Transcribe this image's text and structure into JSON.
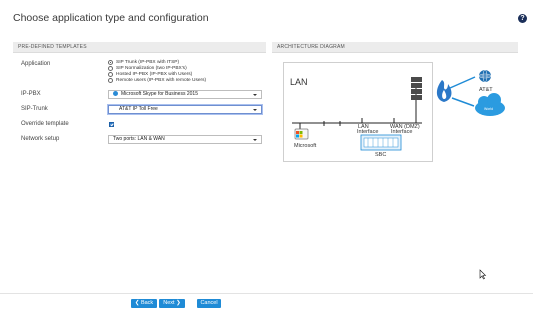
{
  "page": {
    "title": "Choose application type and configuration",
    "help_icon": "?"
  },
  "left": {
    "header": "PRE-DEFINED TEMPLATES",
    "application_label": "Application",
    "application_options": [
      "SIP Trunk (IP-PBX with ITSP)",
      "SIP Normalization (two IP-PBX's)",
      "Hosted IP-PBX (IP-PBX with Users)",
      "Remote users (IP-PBX with remote Users)"
    ],
    "ippbx_label": "IP-PBX",
    "ippbx_value": "Microsoft Skype for Business 2015",
    "siptrunk_label": "SIP-Trunk",
    "siptrunk_value": "AT&T IP Toll Free",
    "override_label": "Override template",
    "network_label": "Network setup",
    "network_value": "Two ports: LAN & WAN"
  },
  "right": {
    "header": "ARCHITECTURE DIAGRAM",
    "diagram": {
      "lan_label": "LAN",
      "lan_interface_label_1": "LAN",
      "lan_interface_label_2": "Interface",
      "wan_interface_label_1": "WAN (DMZ)",
      "wan_interface_label_2": "Interface",
      "microsoft_label": "Microsoft",
      "sbc_label": "SBC",
      "att_label": "AT&T",
      "cloud_label": "World"
    }
  },
  "footer": {
    "back_label": "❮ Back",
    "next_label": "Next ❯",
    "cancel_label": "Cancel"
  },
  "colors": {
    "accent": "#1f8bd6",
    "fire": "#2b78c8",
    "globe": "#1f6fb2"
  }
}
